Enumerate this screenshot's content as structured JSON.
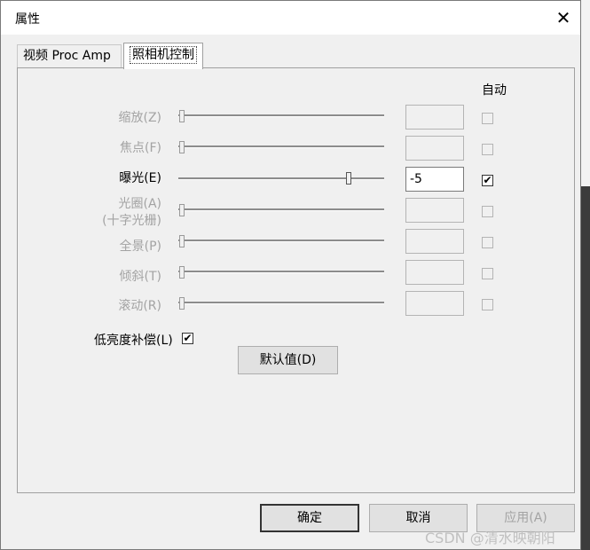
{
  "window": {
    "title": "属性",
    "close_glyph": "✕"
  },
  "tabs": [
    {
      "label": "视频 Proc Amp",
      "selected": false
    },
    {
      "label": "照相机控制",
      "selected": true
    }
  ],
  "auto_header": "自动",
  "controls": [
    {
      "key": "zoom",
      "label": "缩放(Z)",
      "value": "",
      "enabled": false,
      "auto": false,
      "slider_pos": 0.0
    },
    {
      "key": "focus",
      "label": "焦点(F)",
      "value": "",
      "enabled": false,
      "auto": false,
      "slider_pos": 0.0
    },
    {
      "key": "exposure",
      "label": "曝光(E)",
      "value": "-5",
      "enabled": true,
      "auto": true,
      "slider_pos": 0.83
    },
    {
      "key": "iris",
      "label": "光圈(A)",
      "label2": "(十字光栅)",
      "value": "",
      "enabled": false,
      "auto": false,
      "slider_pos": 0.0
    },
    {
      "key": "pan",
      "label": "全景(P)",
      "value": "",
      "enabled": false,
      "auto": false,
      "slider_pos": 0.0
    },
    {
      "key": "tilt",
      "label": "倾斜(T)",
      "value": "",
      "enabled": false,
      "auto": false,
      "slider_pos": 0.0
    },
    {
      "key": "roll",
      "label": "滚动(R)",
      "value": "",
      "enabled": false,
      "auto": false,
      "slider_pos": 0.0
    }
  ],
  "low_light": {
    "label": "低亮度补偿(L)",
    "checked": true
  },
  "buttons": {
    "default": "默认值(D)",
    "ok": "确定",
    "cancel": "取消",
    "apply": "应用(A)"
  },
  "check_glyph": "✔",
  "watermark": "CSDN @清水映朝阳"
}
